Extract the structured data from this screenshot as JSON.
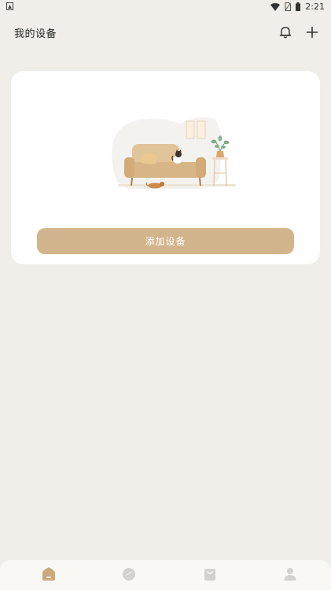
{
  "status_bar": {
    "time": "2:21",
    "icons": [
      "notification-icon",
      "wifi-icon",
      "no-sim-icon",
      "battery-icon"
    ]
  },
  "header": {
    "title": "我的设备",
    "actions": [
      "bell-icon",
      "plus-icon"
    ]
  },
  "device_card": {
    "illustration": "living-room-sofa-cat-dog-illustration",
    "add_device_label": "添加设备"
  },
  "tab_bar": {
    "active_tab": "home",
    "tabs": [
      {
        "id": "home",
        "icon": "home-icon"
      },
      {
        "id": "discover",
        "icon": "chat-bubble-icon"
      },
      {
        "id": "shop",
        "icon": "shopping-bag-icon"
      },
      {
        "id": "profile",
        "icon": "person-icon"
      }
    ]
  },
  "colors": {
    "background": "#f1ede8",
    "card": "#ffffff",
    "accent": "#d2b58c",
    "tab_active": "#c9a97e",
    "tab_inactive": "#d4d2cf"
  }
}
